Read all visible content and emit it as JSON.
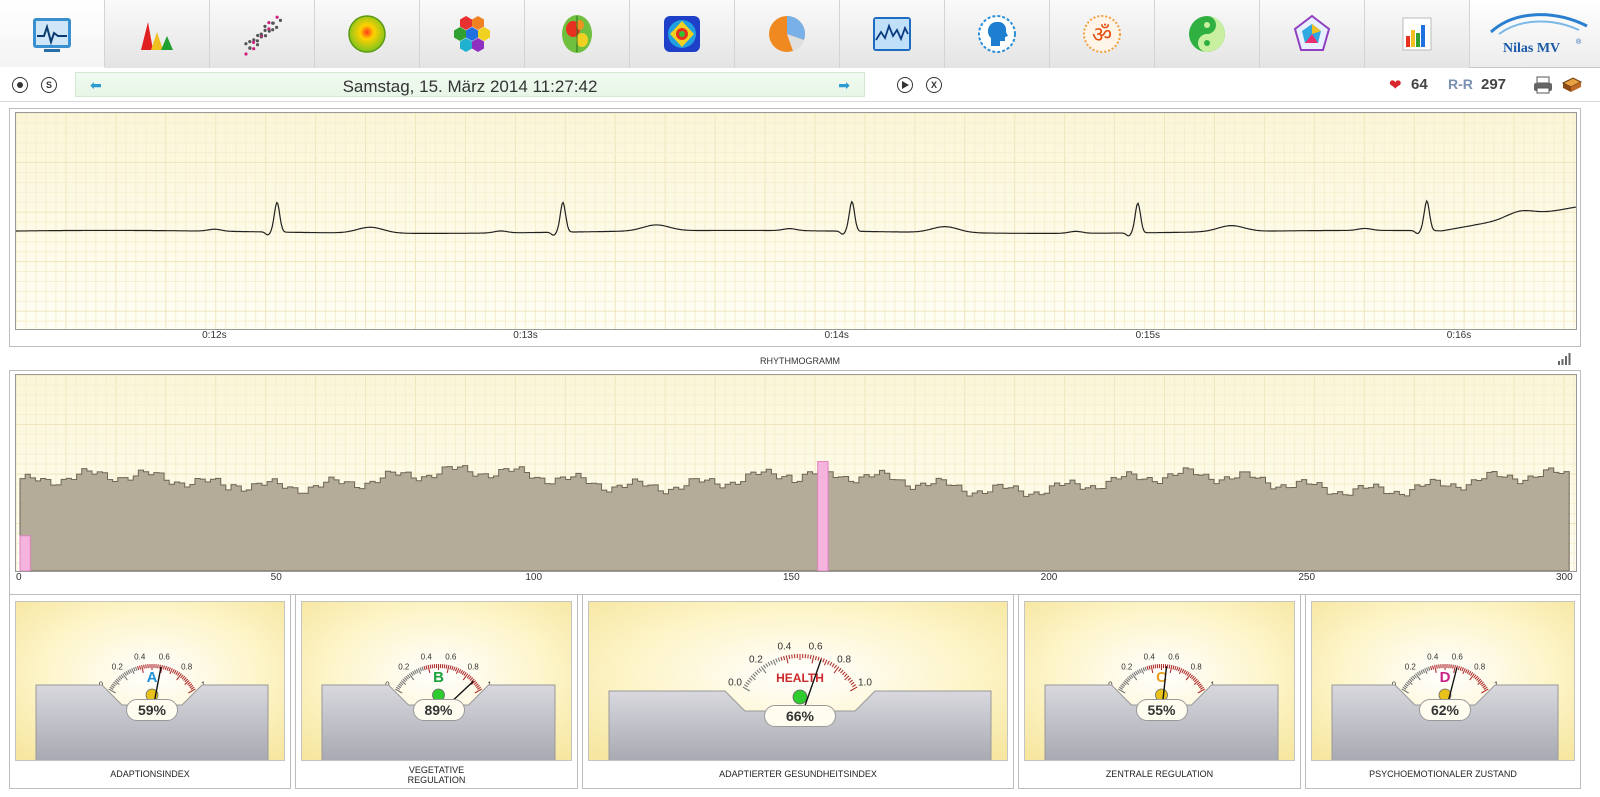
{
  "toolbar": {
    "tabs": [
      {
        "icon": "ecg-monitor-icon"
      },
      {
        "icon": "spectrum-peaks-icon"
      },
      {
        "icon": "scatterplot-icon"
      },
      {
        "icon": "sun-sphere-icon"
      },
      {
        "icon": "hexagon-cluster-icon"
      },
      {
        "icon": "brain-map-icon"
      },
      {
        "icon": "chakra-mandala-icon"
      },
      {
        "icon": "pie-chart-icon"
      },
      {
        "icon": "line-graph-icon"
      },
      {
        "icon": "head-profile-icon"
      },
      {
        "icon": "om-symbol-icon"
      },
      {
        "icon": "yin-yang-icon"
      },
      {
        "icon": "pentagon-radar-icon"
      },
      {
        "icon": "bar-chart-icon"
      }
    ],
    "logo_text": "Nilas MV",
    "logo_reg": "®"
  },
  "nav": {
    "btn1": "",
    "btn2": "S",
    "datetime": "Samstag, 15. März 2014 11:27:42",
    "btn3": "",
    "btn4": "X",
    "heart_rate": "64",
    "rr_label": "R-R",
    "rr_value": "297"
  },
  "chart_data": [
    {
      "type": "line",
      "title": "",
      "x_ticks": [
        "0:12s",
        "0:13s",
        "0:14s",
        "0:15s",
        "0:16s"
      ],
      "x_tick_values": [
        12,
        13,
        14,
        15,
        16
      ],
      "xlim": [
        11.36,
        16.38
      ],
      "r_peaks_s": [
        12.2,
        13.12,
        14.05,
        14.97,
        15.9
      ],
      "grid": true
    },
    {
      "type": "area",
      "title": "RHYTHMOGRAMM",
      "x_ticks": [
        "0",
        "50",
        "100",
        "150",
        "200",
        "250",
        "300"
      ],
      "xlim": [
        0,
        300
      ],
      "highlight_indices": [
        0,
        155
      ],
      "baseline_level": 0.45,
      "grid": true
    }
  ],
  "gauges": [
    {
      "letter": "A",
      "letter_color": "#1f8fd8",
      "value": 0.59,
      "percent": "59%",
      "label": "ADAPTIONSINDEX",
      "led": "#e8c21a"
    },
    {
      "letter": "B",
      "letter_color": "#1aa23a",
      "value": 0.89,
      "percent": "89%",
      "label": "VEGETATIVE\nREGULATION",
      "led": "#2ecc2e"
    },
    {
      "letter": "HEALTH",
      "letter_color": "#cc2a2a",
      "value": 0.66,
      "percent": "66%",
      "label": "ADAPTIERTER GESUNDHEITSINDEX",
      "led": "#2ecc2e"
    },
    {
      "letter": "C",
      "letter_color": "#e8a020",
      "value": 0.55,
      "percent": "55%",
      "label": "ZENTRALE REGULATION",
      "led": "#e8c21a"
    },
    {
      "letter": "D",
      "letter_color": "#cc2288",
      "value": 0.62,
      "percent": "62%",
      "label": "PSYCHOEMOTIONALER ZUSTAND",
      "led": "#e8c21a"
    }
  ],
  "scale_small": [
    "0",
    "0.2",
    "0.4",
    "0.6",
    "0.8",
    "1"
  ],
  "scale_large": [
    "0.0",
    "0.2",
    "0.4",
    "0.6",
    "0.8",
    "1.0"
  ]
}
